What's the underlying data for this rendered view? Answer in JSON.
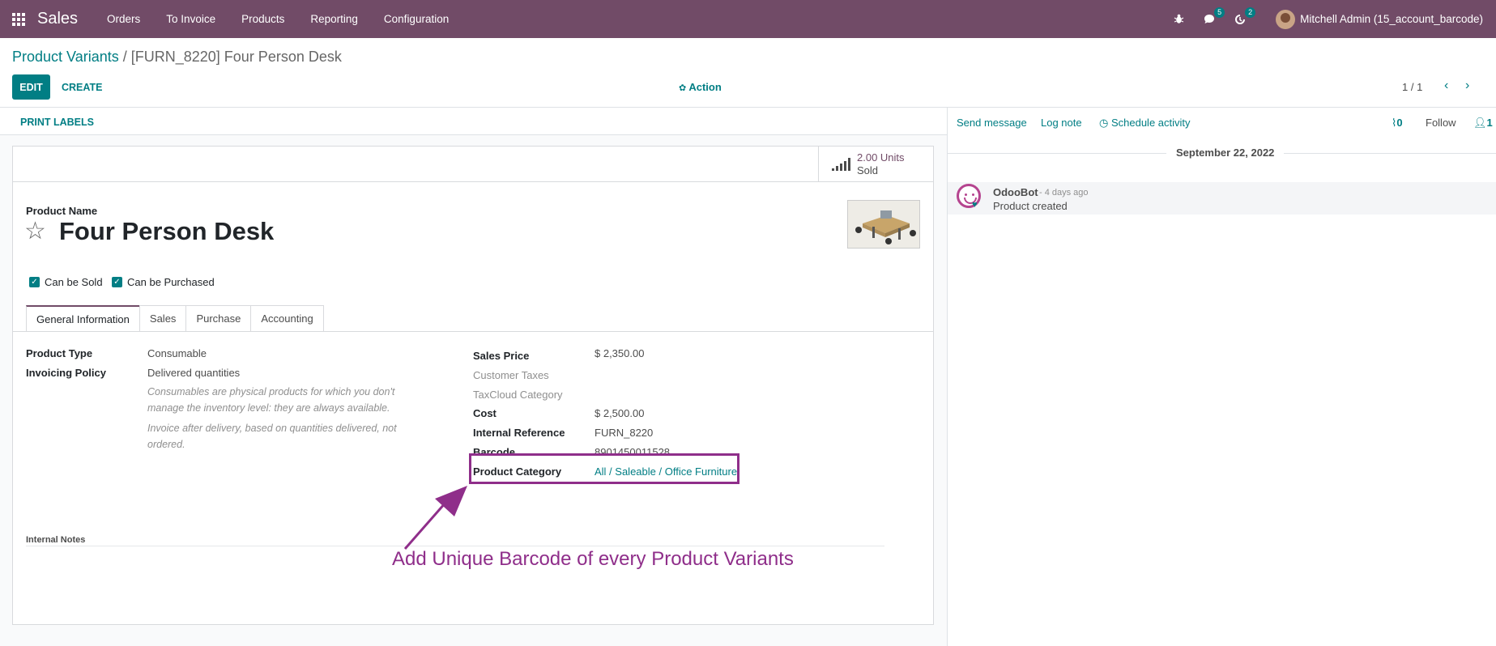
{
  "navbar": {
    "app_name": "Sales",
    "menu": [
      "Orders",
      "To Invoice",
      "Products",
      "Reporting",
      "Configuration"
    ],
    "messages_count": "5",
    "activities_count": "2",
    "user": "Mitchell Admin (15_account_barcode)"
  },
  "control_panel": {
    "breadcrumb_parent": "Product Variants",
    "breadcrumb_sep": " / ",
    "breadcrumb_current": "[FURN_8220] Four Person Desk",
    "edit_label": "EDIT",
    "create_label": "CREATE",
    "action_label": "Action",
    "pager": "1 / 1"
  },
  "form": {
    "print_labels": "PRINT LABELS",
    "smart_button": {
      "value": "2.00 Units",
      "label": "Sold"
    },
    "product_name_label": "Product Name",
    "product_name": "Four Person Desk",
    "can_be_sold": "Can be Sold",
    "can_be_purchased": "Can be Purchased",
    "tabs": [
      "General Information",
      "Sales",
      "Purchase",
      "Accounting"
    ],
    "left_fields": {
      "product_type_label": "Product Type",
      "product_type": "Consumable",
      "invoicing_policy_label": "Invoicing Policy",
      "invoicing_policy": "Delivered quantities",
      "help_consumable": "Consumables are physical products for which you don't manage the inventory level: they are always available.",
      "help_invoice": "Invoice after delivery, based on quantities delivered, not ordered."
    },
    "right_fields": {
      "sales_price_label": "Sales Price",
      "sales_price": "$ 2,350.00",
      "customer_taxes_label": "Customer Taxes",
      "taxcloud_label": "TaxCloud Category",
      "cost_label": "Cost",
      "cost": "$ 2,500.00",
      "internal_ref_label": "Internal Reference",
      "internal_ref": "FURN_8220",
      "barcode_label": "Barcode",
      "barcode": "8901450011528",
      "category_label": "Product Category",
      "category": "All / Saleable / Office Furniture"
    },
    "internal_notes_label": "Internal Notes"
  },
  "annotation": "Add Unique Barcode of every Product Variants",
  "chatter": {
    "send_message": "Send message",
    "log_note": "Log note",
    "schedule_activity": "Schedule activity",
    "attachments": "0",
    "follow": "Follow",
    "followers": "1",
    "date": "September 22, 2022",
    "message": {
      "author": "OdooBot",
      "ago": "- 4 days ago",
      "text": "Product created"
    }
  },
  "colors": {
    "brand": "#714b67",
    "accent": "#017e84",
    "annotation": "#8f2e8a"
  }
}
